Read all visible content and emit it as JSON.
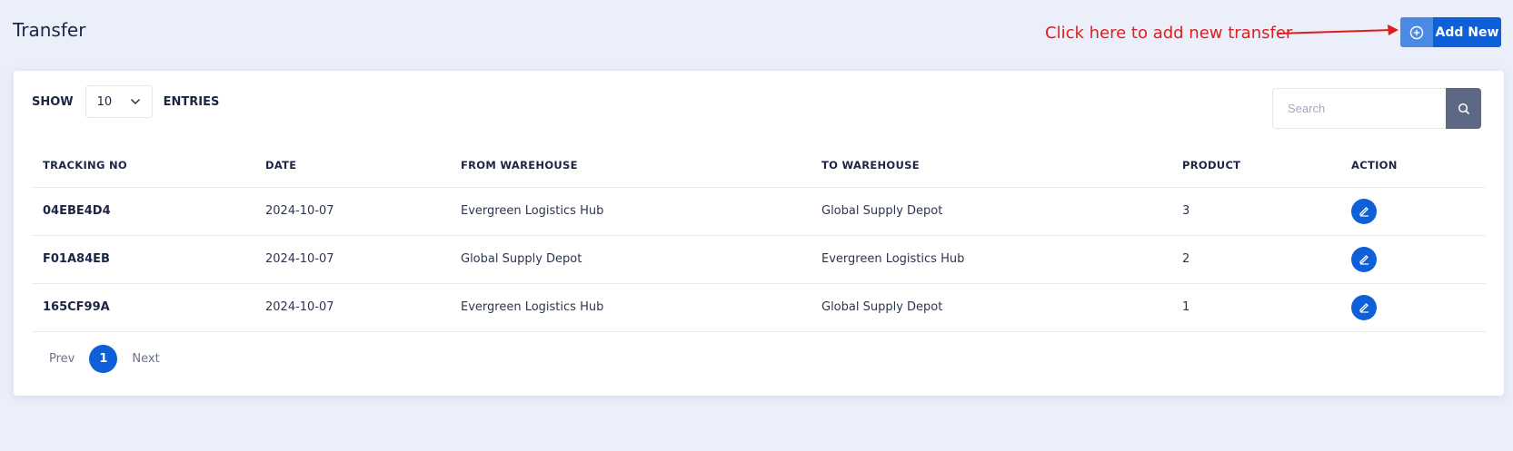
{
  "header": {
    "title": "Transfer",
    "add_button_label": "Add New",
    "annotation_text": "Click here to add new transfer"
  },
  "controls": {
    "show_label": "SHOW",
    "entries_value": "10",
    "entries_label": "ENTRIES",
    "search_placeholder": "Search"
  },
  "table": {
    "columns": [
      "TRACKING NO",
      "DATE",
      "FROM WAREHOUSE",
      "TO WAREHOUSE",
      "PRODUCT",
      "ACTION"
    ],
    "rows": [
      {
        "tracking_no": "04EBE4D4",
        "date": "2024-10-07",
        "from_warehouse": "Evergreen Logistics Hub",
        "to_warehouse": "Global Supply Depot",
        "product": "3"
      },
      {
        "tracking_no": "F01A84EB",
        "date": "2024-10-07",
        "from_warehouse": "Global Supply Depot",
        "to_warehouse": "Evergreen Logistics Hub",
        "product": "2"
      },
      {
        "tracking_no": "165CF99A",
        "date": "2024-10-07",
        "from_warehouse": "Evergreen Logistics Hub",
        "to_warehouse": "Global Supply Depot",
        "product": "1"
      }
    ]
  },
  "pagination": {
    "prev_label": "Prev",
    "current_page": "1",
    "next_label": "Next"
  },
  "colors": {
    "primary": "#0f5fd9",
    "annotation": "#e01d1d",
    "background": "#ebeff9"
  },
  "icons": {
    "add": "plus-circle-icon",
    "search": "search-icon",
    "edit": "pencil-icon",
    "dropdown": "chevron-down-icon"
  }
}
